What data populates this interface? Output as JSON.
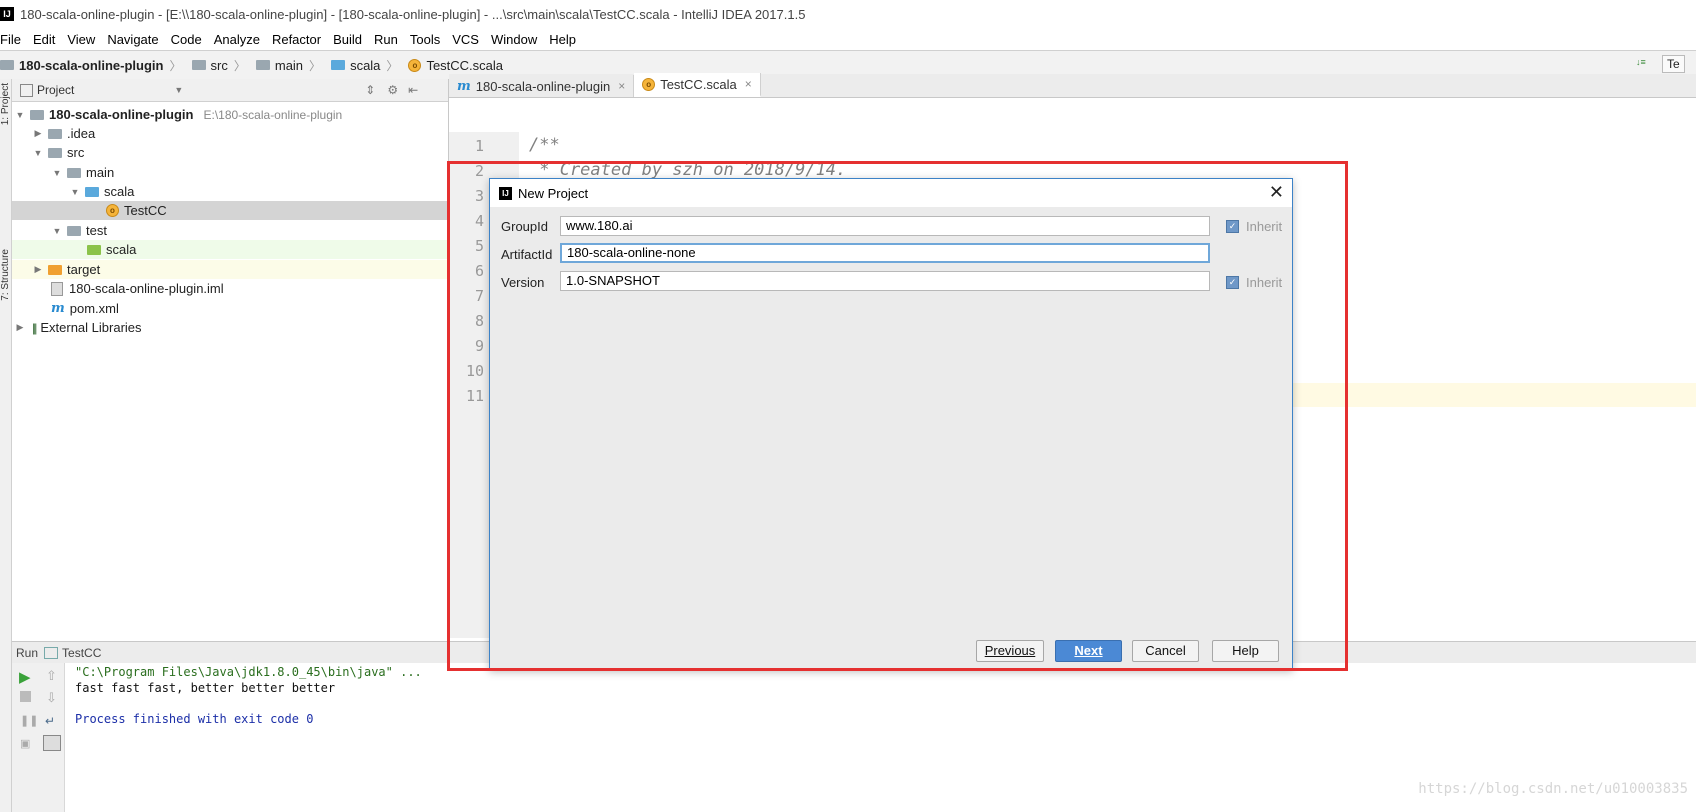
{
  "window": {
    "title": "180-scala-online-plugin - [E:\\\\180-scala-online-plugin] - [180-scala-online-plugin] - ...\\src\\main\\scala\\TestCC.scala - IntelliJ IDEA 2017.1.5",
    "logo": "IJ"
  },
  "menu": [
    "File",
    "Edit",
    "View",
    "Navigate",
    "Code",
    "Analyze",
    "Refactor",
    "Build",
    "Run",
    "Tools",
    "VCS",
    "Window",
    "Help"
  ],
  "breadcrumb": {
    "project": "180-scala-online-plugin",
    "items": [
      "src",
      "main",
      "scala",
      "TestCC.scala"
    ],
    "right_label": "Te"
  },
  "stripe": {
    "project": "1: Project",
    "structure": "7: Structure"
  },
  "project_panel": {
    "title": "Project",
    "root": {
      "name": "180-scala-online-plugin",
      "path": "E:\\180-scala-online-plugin"
    },
    "tree": [
      {
        "label": ".idea",
        "icon": "folder-icon"
      },
      {
        "label": "src",
        "icon": "folder-icon"
      },
      {
        "label": "main",
        "icon": "folder-icon"
      },
      {
        "label": "scala",
        "icon": "source-folder-icon"
      },
      {
        "label": "TestCC",
        "icon": "scala-object-icon"
      },
      {
        "label": "test",
        "icon": "folder-icon"
      },
      {
        "label": "scala",
        "icon": "test-folder-icon"
      },
      {
        "label": "target",
        "icon": "excluded-folder-icon"
      },
      {
        "label": "180-scala-online-plugin.iml",
        "icon": "iml-file-icon"
      },
      {
        "label": "pom.xml",
        "icon": "maven-icon"
      },
      {
        "label": "External Libraries",
        "icon": "libraries-icon"
      }
    ]
  },
  "editor": {
    "tabs": [
      {
        "label": "180-scala-online-plugin",
        "icon": "maven-icon",
        "active": false
      },
      {
        "label": "TestCC.scala",
        "icon": "scala-object-icon",
        "active": true
      }
    ],
    "line_numbers": [
      "1",
      "2",
      "3",
      "4",
      "5",
      "6",
      "7",
      "8",
      "9",
      "10",
      "11"
    ],
    "code": [
      "/**",
      " * Created by szh on 2018/9/14."
    ]
  },
  "dialog": {
    "title": "New Project",
    "fields": {
      "group_label": "GroupId",
      "group_value": "www.180.ai",
      "artifact_label": "ArtifactId",
      "artifact_value": "180-scala-online-none",
      "version_label": "Version",
      "version_value": "1.0-SNAPSHOT"
    },
    "inherit_label": "Inherit",
    "buttons": {
      "previous": "Previous",
      "next": "Next",
      "cancel": "Cancel",
      "help": "Help"
    }
  },
  "run_panel": {
    "label": "Run",
    "config": "TestCC",
    "console": [
      "\"C:\\Program Files\\Java\\jdk1.8.0_45\\bin\\java\" ...",
      "fast fast fast, better better better",
      "",
      "Process finished with exit code 0"
    ]
  },
  "watermark": "https://blog.csdn.net/u010003835",
  "colors": {
    "highlight_box": "#e53030",
    "primary_button": "#4b89d5",
    "console_cmd": "#2a6e1e",
    "console_exit": "#1c2fa8"
  }
}
